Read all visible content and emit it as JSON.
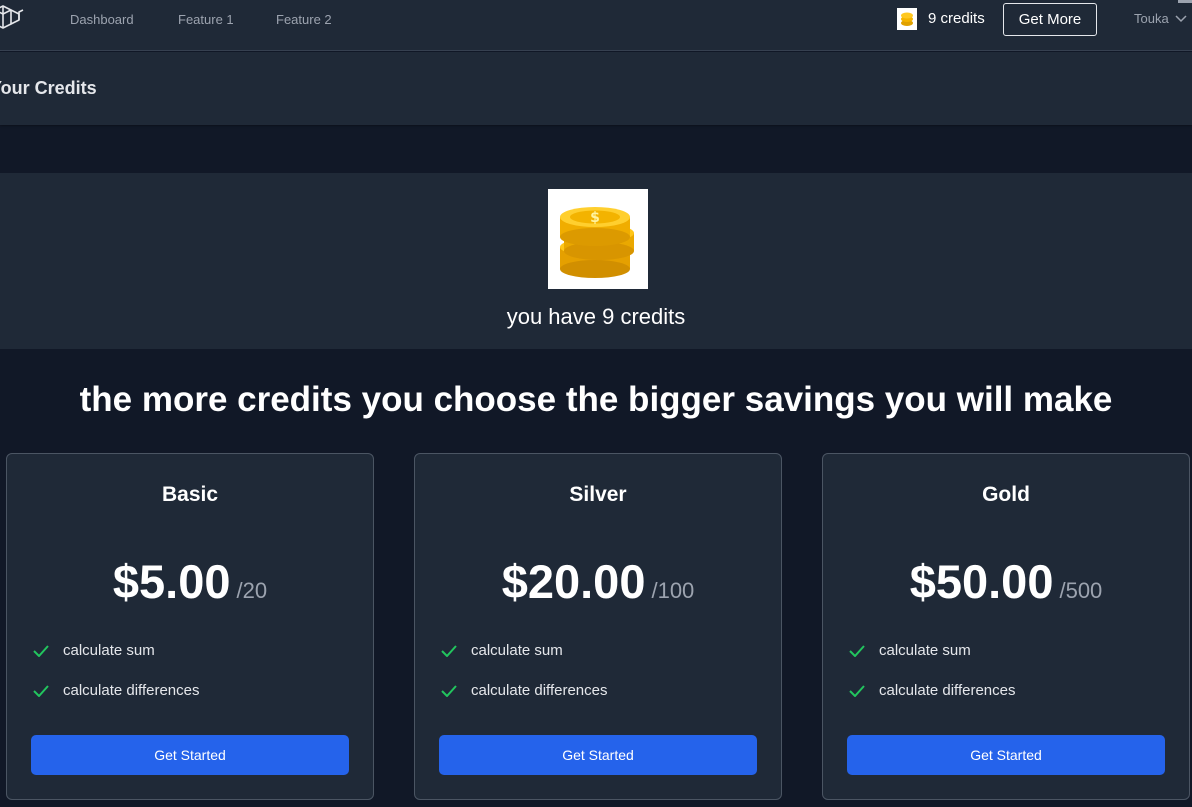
{
  "nav": {
    "links": [
      "Dashboard",
      "Feature 1",
      "Feature 2"
    ],
    "credits_label": "9 credits",
    "get_more_label": "Get More",
    "user_name": "Touka"
  },
  "header": {
    "title": "Your Credits"
  },
  "balance": {
    "text": "you have 9 credits"
  },
  "headline": "the more credits you choose the bigger savings you will make",
  "plans": [
    {
      "name": "Basic",
      "price": "$5.00",
      "credits": "/20",
      "features": [
        "calculate sum",
        "calculate differences"
      ],
      "cta": "Get Started"
    },
    {
      "name": "Silver",
      "price": "$20.00",
      "credits": "/100",
      "features": [
        "calculate sum",
        "calculate differences"
      ],
      "cta": "Get Started"
    },
    {
      "name": "Gold",
      "price": "$50.00",
      "credits": "/500",
      "features": [
        "calculate sum",
        "calculate differences"
      ],
      "cta": "Get Started"
    }
  ],
  "colors": {
    "background": "#111827",
    "panel": "#1f2937",
    "accent": "#2563eb",
    "check": "#22c55e",
    "coin": "#f5b400"
  }
}
